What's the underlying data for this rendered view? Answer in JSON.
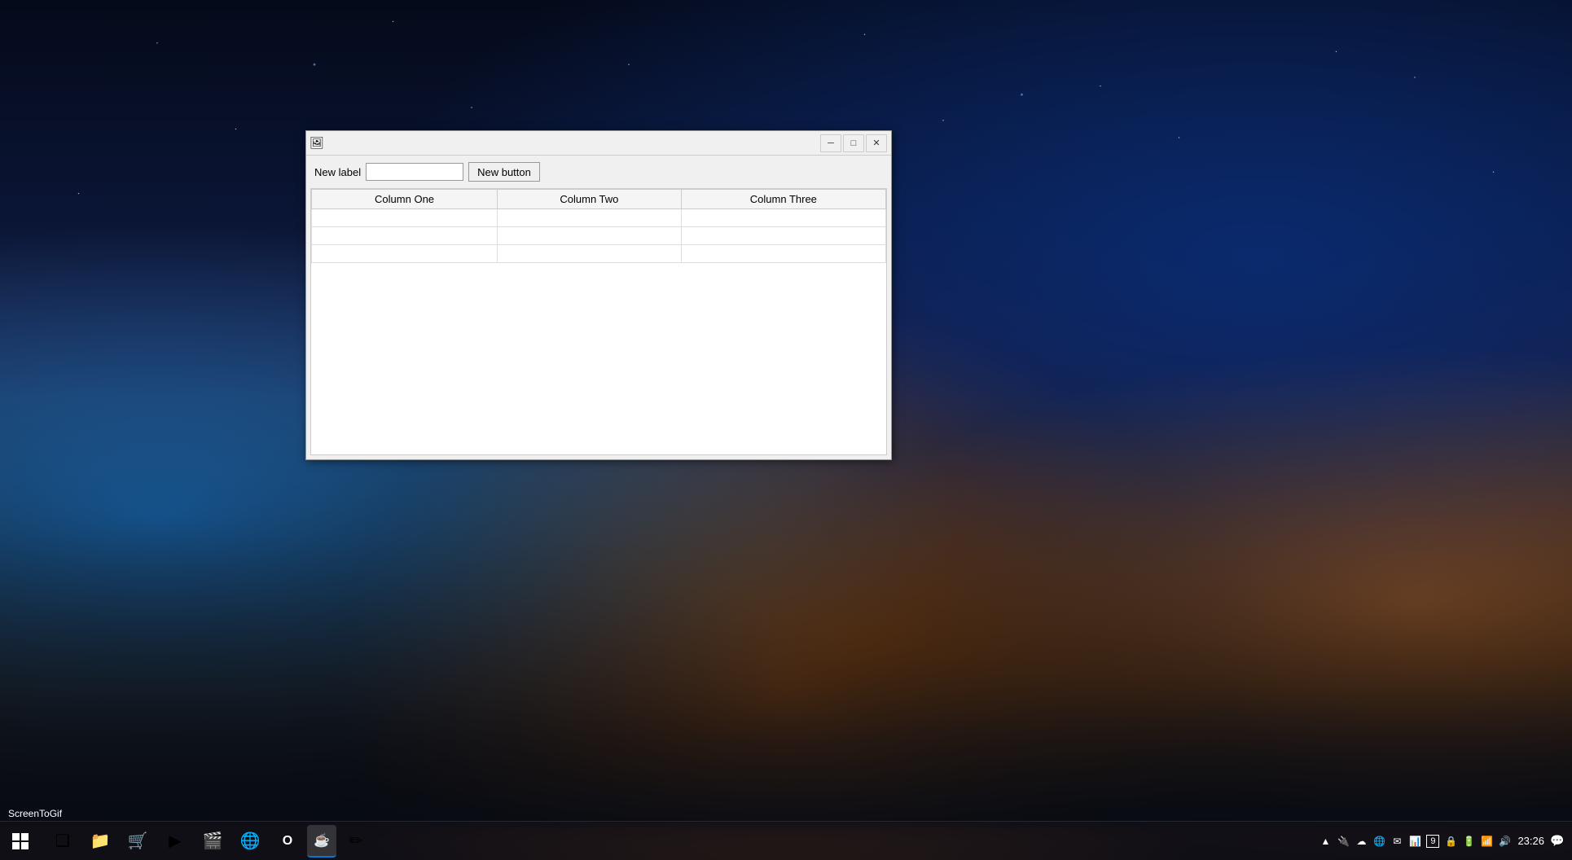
{
  "desktop": {
    "background": "space-mountains"
  },
  "window": {
    "title": "",
    "icon": "🖼",
    "controls": {
      "minimize": "─",
      "maximize": "□",
      "close": "✕"
    },
    "toolbar": {
      "label": "New label",
      "input_value": "",
      "button_label": "New button"
    },
    "table": {
      "columns": [
        "Column One",
        "Column Two",
        "Column Three"
      ],
      "rows": [
        [
          "",
          "",
          ""
        ],
        [
          "",
          "",
          ""
        ],
        [
          "",
          "",
          ""
        ]
      ]
    }
  },
  "taskbar": {
    "apps": [
      {
        "name": "start",
        "icon": "⊞"
      },
      {
        "name": "task-view",
        "icon": "❑"
      },
      {
        "name": "file-explorer",
        "icon": "📁"
      },
      {
        "name": "store",
        "icon": "🛍"
      },
      {
        "name": "winamp",
        "icon": "🎵"
      },
      {
        "name": "vlc",
        "icon": "🎬"
      },
      {
        "name": "chrome",
        "icon": "🌐"
      },
      {
        "name": "opera",
        "icon": "O"
      },
      {
        "name": "java",
        "icon": "☕"
      },
      {
        "name": "other",
        "icon": "✏"
      }
    ],
    "active_app": {
      "icon": "☕",
      "label": ""
    },
    "systray": {
      "icons": [
        "▲",
        "🔌",
        "💻",
        "🌐",
        "📧",
        "📊",
        "9",
        "🔒",
        "🔋",
        "📶",
        "🔊"
      ]
    },
    "clock": {
      "time": "23:26",
      "date": ""
    },
    "screentogif_label": "ScreenToGif"
  }
}
